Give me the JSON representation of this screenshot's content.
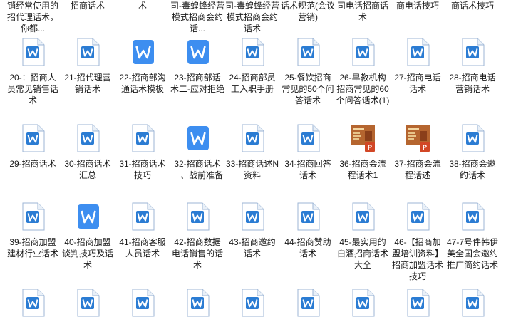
{
  "explorer": {
    "items": [
      {
        "label": "销经常使用的招代理话术，你都...",
        "icon": "word-doc-icon"
      },
      {
        "label": "招商话术",
        "icon": "word-doc-icon"
      },
      {
        "label": "术",
        "icon": "word-doc-icon"
      },
      {
        "label": "司-毒蝗蜂经营模式招商会约话...",
        "icon": "word-doc-icon"
      },
      {
        "label": "司-毒蝗蜂经营模式招商会约话术",
        "icon": "word-doc-icon"
      },
      {
        "label": "话术规范(会议营销)",
        "icon": "word-doc-icon"
      },
      {
        "label": "司电话招商话术",
        "icon": "word-doc-icon"
      },
      {
        "label": "商电话技巧",
        "icon": "word-doc-icon"
      },
      {
        "label": "商话术技巧",
        "icon": "word-doc-icon"
      },
      {
        "label": "20-：招商人员常见销售话术",
        "icon": "word-doc-icon"
      },
      {
        "label": "21-招代理营销话术",
        "icon": "word-doc-icon"
      },
      {
        "label": "22-招商部沟通话术模板",
        "icon": "wps-word-icon"
      },
      {
        "label": "23-招商部话术二-应对拒绝",
        "icon": "wps-word-icon"
      },
      {
        "label": "24-招商部员工入职手册",
        "icon": "word-doc-icon"
      },
      {
        "label": "25-餐饮招商常见的50个问答话术",
        "icon": "word-doc-icon"
      },
      {
        "label": "26-早教机构 招商常见的60个问答话术(1)",
        "icon": "word-doc-icon"
      },
      {
        "label": "27-招商电话话术",
        "icon": "word-doc-icon"
      },
      {
        "label": "28-招商电话营销话术",
        "icon": "word-doc-icon"
      },
      {
        "label": "29-招商话术",
        "icon": "word-doc-icon"
      },
      {
        "label": "30-招商话术汇总",
        "icon": "word-doc-icon"
      },
      {
        "label": "31-招商话术技巧",
        "icon": "word-doc-icon"
      },
      {
        "label": "32-招商话术一、战前准备",
        "icon": "wps-word-icon"
      },
      {
        "label": "33-招商话述N资料",
        "icon": "word-doc-icon"
      },
      {
        "label": "34-招商回答话术",
        "icon": "word-doc-icon"
      },
      {
        "label": "36-招商会流程话术1",
        "icon": "ppt-thumbnail-icon"
      },
      {
        "label": "37-招商会流程话述",
        "icon": "ppt-thumbnail-icon"
      },
      {
        "label": "38-招商会邀约话术",
        "icon": "word-doc-icon"
      },
      {
        "label": "39-招商加盟建材行业话术",
        "icon": "word-doc-icon"
      },
      {
        "label": "40-招商加盟谈判技巧及话术",
        "icon": "wps-word-icon"
      },
      {
        "label": "41-招商客服人员话术",
        "icon": "word-doc-icon"
      },
      {
        "label": "42-招商数据电话销售的话术",
        "icon": "word-doc-icon"
      },
      {
        "label": "43-招商邀约话术",
        "icon": "word-doc-icon"
      },
      {
        "label": "44-招商赞助话术",
        "icon": "word-doc-icon"
      },
      {
        "label": "45-最实用的白酒招商话术大全",
        "icon": "word-doc-icon"
      },
      {
        "label": "46-【招商加盟培训资料】招商加盟话术技巧",
        "icon": "word-doc-icon"
      },
      {
        "label": "47-7号件韩伊美全国会邀约推广简约话术",
        "icon": "word-doc-icon"
      },
      {
        "label": "",
        "icon": "word-doc-icon"
      },
      {
        "label": "",
        "icon": "word-doc-icon"
      },
      {
        "label": "",
        "icon": "word-doc-icon"
      },
      {
        "label": "",
        "icon": "word-doc-icon"
      },
      {
        "label": "",
        "icon": "word-doc-icon"
      },
      {
        "label": "",
        "icon": "word-doc-icon"
      },
      {
        "label": "",
        "icon": "word-doc-icon"
      },
      {
        "label": "",
        "icon": "word-doc-icon"
      },
      {
        "label": "",
        "icon": "word-doc-icon"
      }
    ],
    "colors": {
      "word_blue": "#2b7cd3",
      "wps_blue": "#3d8ef0",
      "ppt_red": "#d24726",
      "ppt_thumb": "#b5652f"
    }
  }
}
